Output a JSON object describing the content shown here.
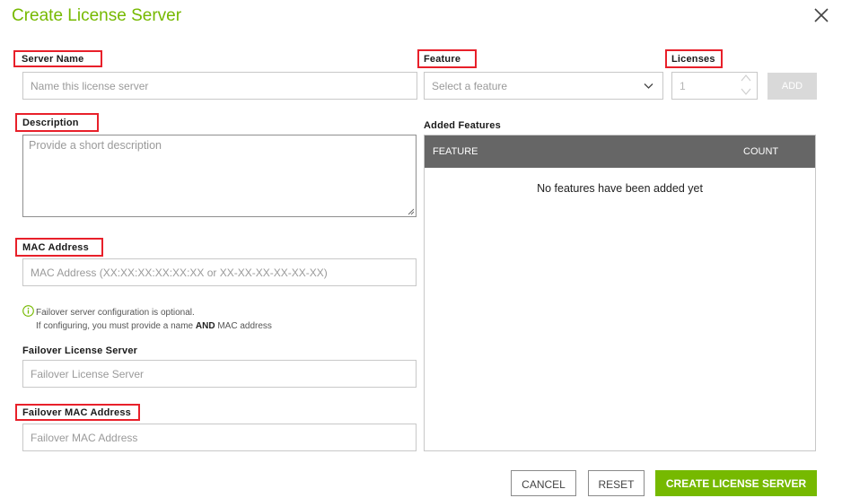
{
  "dialog": {
    "title": "Create License Server",
    "close_icon": "close-icon"
  },
  "server_name": {
    "label": "Server Name",
    "placeholder": "Name this license server",
    "value": ""
  },
  "description": {
    "label": "Description",
    "placeholder": "Provide a short description",
    "value": ""
  },
  "mac_address": {
    "label": "MAC Address",
    "placeholder": "MAC Address (XX:XX:XX:XX:XX:XX or XX-XX-XX-XX-XX-XX)",
    "value": ""
  },
  "failover_info": {
    "icon": "info-circle-icon",
    "line1": "Failover server configuration is optional.",
    "line2_before": "If configuring, you must provide a name ",
    "line2_bold": "AND",
    "line2_after": " MAC address"
  },
  "failover_server": {
    "label": "Failover License Server",
    "placeholder": "Failover License Server",
    "value": ""
  },
  "failover_mac": {
    "label": "Failover MAC Address",
    "placeholder": "Failover MAC Address",
    "value": ""
  },
  "feature": {
    "label": "Feature",
    "placeholder": "Select a feature",
    "selected": ""
  },
  "licenses": {
    "label": "Licenses",
    "value": "1"
  },
  "add_button": {
    "label": "ADD",
    "enabled": false
  },
  "added_features": {
    "heading": "Added Features",
    "columns": [
      "FEATURE",
      "COUNT"
    ],
    "rows": [],
    "empty_message": "No features have been added yet"
  },
  "footer": {
    "cancel_label": "CANCEL",
    "reset_label": "RESET",
    "create_label": "CREATE LICENSE SERVER"
  },
  "colors": {
    "brand_green": "#76b900",
    "highlight_red": "#e8202a",
    "table_header": "#666666"
  }
}
